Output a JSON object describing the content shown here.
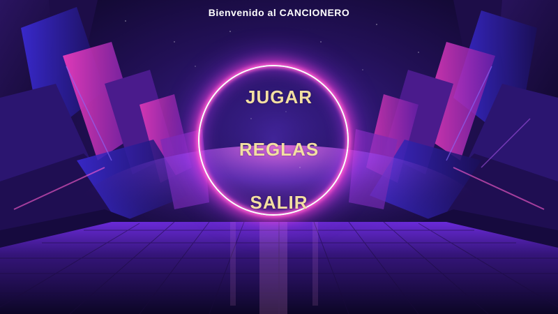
{
  "header": {
    "welcome_text": "Bienvenido al CANCIONERO"
  },
  "menu": {
    "play_label": "JUGAR",
    "rules_label": "REGLAS",
    "exit_label": "SALIR"
  },
  "colors": {
    "menu_text": "#f3dfa2",
    "ring_glow": "#ff5fd0",
    "background": "#0b0620"
  }
}
